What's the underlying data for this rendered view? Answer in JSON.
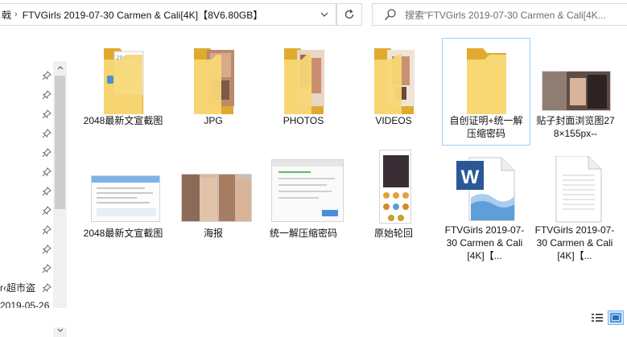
{
  "address_bar": {
    "previous_crumb": "戟",
    "current_folder": "FTVGirls 2019-07-30 Carmen & Cali[4K]【8V6.80GB】"
  },
  "search": {
    "placeholder": "搜索\"FTVGirls 2019-07-30 Carmen & Cali[4K..."
  },
  "nav": {
    "pin_count": 12,
    "partial_item_1": "r‹超市盗",
    "partial_item_2": "2019-05-26"
  },
  "files": [
    {
      "label": "2048最新文宣截图",
      "type": "folder-with-doc"
    },
    {
      "label": "JPG",
      "type": "folder-with-photo"
    },
    {
      "label": "PHOTOS",
      "type": "folder-with-photo"
    },
    {
      "label": "VIDEOS",
      "type": "folder-with-photo"
    },
    {
      "label": "自创证明+统一解压缩密码",
      "type": "folder-empty"
    },
    {
      "label": "贴子封面浏览图278×155px--",
      "type": "image"
    },
    {
      "label": "2048最新文宣截图",
      "type": "image"
    },
    {
      "label": "海报",
      "type": "image"
    },
    {
      "label": "统一解压缩密码",
      "type": "image"
    },
    {
      "label": "原始轮回",
      "type": "image"
    },
    {
      "label": "FTVGirls 2019-07-30 Carmen & Cali[4K]【...",
      "type": "word-doc"
    },
    {
      "label": "FTVGirls 2019-07-30 Carmen & Cali[4K]【...",
      "type": "text-doc"
    }
  ],
  "colors": {
    "folder_front": "#f8d775",
    "folder_back": "#e0a930",
    "selection_border": "#99d1ff",
    "word_blue": "#2b5797"
  }
}
